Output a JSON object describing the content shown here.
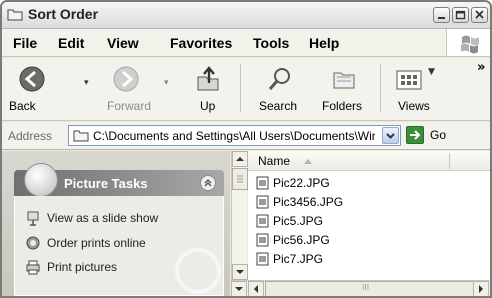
{
  "window": {
    "title": "Sort Order"
  },
  "menu": [
    "File",
    "Edit",
    "View",
    "Favorites",
    "Tools",
    "Help"
  ],
  "toolbar": {
    "back": "Back",
    "forward": "Forward",
    "up": "Up",
    "search": "Search",
    "folders": "Folders",
    "views": "Views",
    "overflow": "»"
  },
  "address": {
    "label": "Address",
    "value": "C:\\Documents and Settings\\All Users\\Documents\\WinXP Ha",
    "go": "Go"
  },
  "tasks": {
    "title": "Picture Tasks",
    "items": [
      "View as a slide show",
      "Order prints online",
      "Print pictures"
    ]
  },
  "filelist": {
    "column": "Name",
    "files": [
      "Pic22.JPG",
      "Pic3456.JPG",
      "Pic5.JPG",
      "Pic56.JPG",
      "Pic7.JPG"
    ]
  },
  "scrollbar": {
    "grip": "III"
  }
}
